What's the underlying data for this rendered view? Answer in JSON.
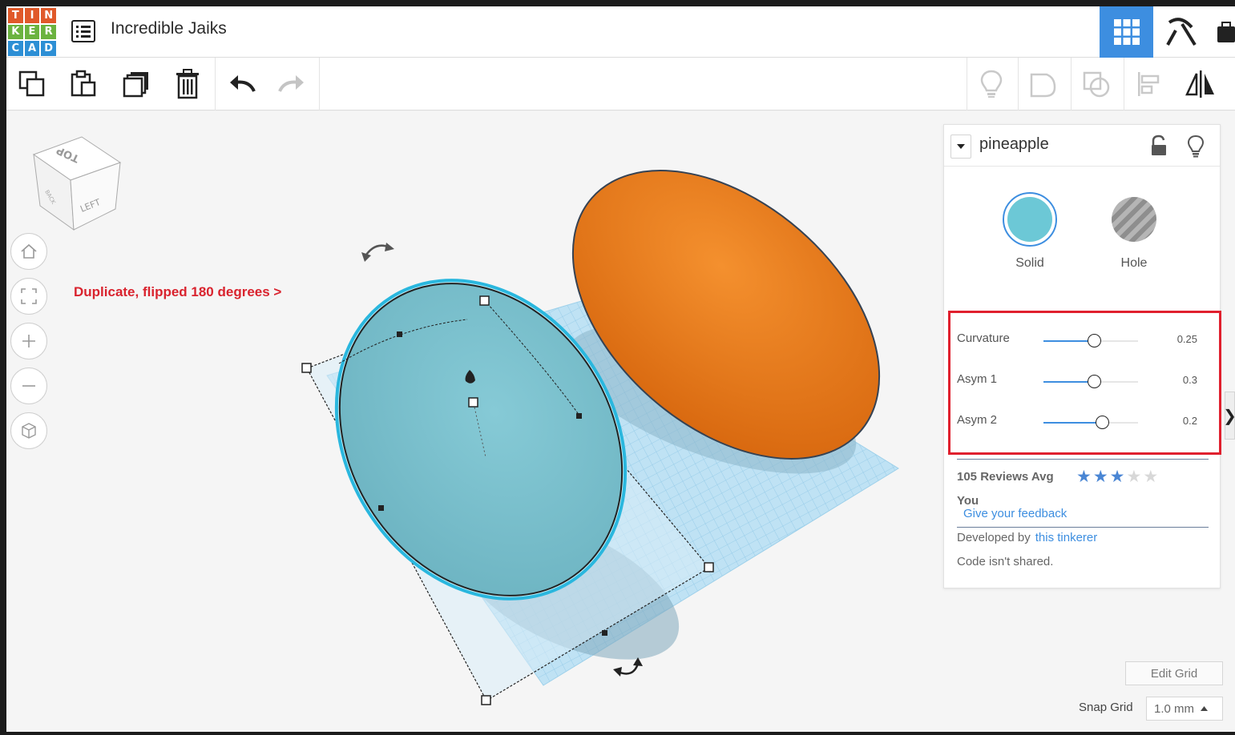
{
  "header": {
    "logo_letters": [
      "T",
      "I",
      "N",
      "K",
      "E",
      "R",
      "C",
      "A",
      "D"
    ],
    "logo_colors": [
      "#e0592a",
      "#e0592a",
      "#e0592a",
      "#6bb33f",
      "#6bb33f",
      "#6bb33f",
      "#2d8fd5",
      "#2d8fd5",
      "#2d8fd5"
    ],
    "title": "Incredible Jaiks",
    "menu_icon": "list-icon",
    "views": [
      {
        "name": "3d-design-view",
        "icon": "grid-icon",
        "active": true
      },
      {
        "name": "blocks-view",
        "icon": "pickaxe-icon",
        "active": false
      },
      {
        "name": "lessons-view",
        "icon": "suitcase-icon",
        "active": false
      }
    ]
  },
  "toolbar": {
    "left_tools": [
      "copy-icon",
      "paste-icon",
      "duplicate-icon",
      "delete-icon",
      "undo-icon",
      "redo-icon"
    ],
    "right_tools": [
      "notes-icon",
      "group-icon",
      "hole-group-icon",
      "align-icon",
      "mirror-icon"
    ]
  },
  "viewport": {
    "viewcube_faces": {
      "top": "TOP",
      "left": "LEFT",
      "back": "BACK"
    },
    "nav_buttons": [
      "home-icon",
      "fit-icon",
      "zoom-in-icon",
      "zoom-out-icon",
      "perspective-icon"
    ],
    "annotation": "Duplicate, flipped 180 degrees  >",
    "colors": {
      "solid": "#6cc8d6",
      "orange": "#ee7d1c",
      "grid": "#bfe2f4",
      "accent": "#3d8ee0",
      "highlight": "#e0202e"
    }
  },
  "panel": {
    "shape_name": "pineapple",
    "solid_label": "Solid",
    "hole_label": "Hole",
    "params": [
      {
        "label": "Curvature",
        "value": "0.25",
        "fraction": 0.53
      },
      {
        "label": "Asym 1",
        "value": "0.3",
        "fraction": 0.53
      },
      {
        "label": "Asym 2",
        "value": "0.2",
        "fraction": 0.62
      }
    ],
    "reviews_label": "105 Reviews Avg",
    "rating": 3,
    "rating_max": 5,
    "you_label": "You",
    "feedback_link": "Give your feedback",
    "developed_by": "Developed by",
    "developer_link": "this tinkerer",
    "code_note": "Code isn't shared."
  },
  "grid_controls": {
    "edit_grid": "Edit Grid",
    "snap_label": "Snap Grid",
    "snap_value": "1.0 mm"
  }
}
